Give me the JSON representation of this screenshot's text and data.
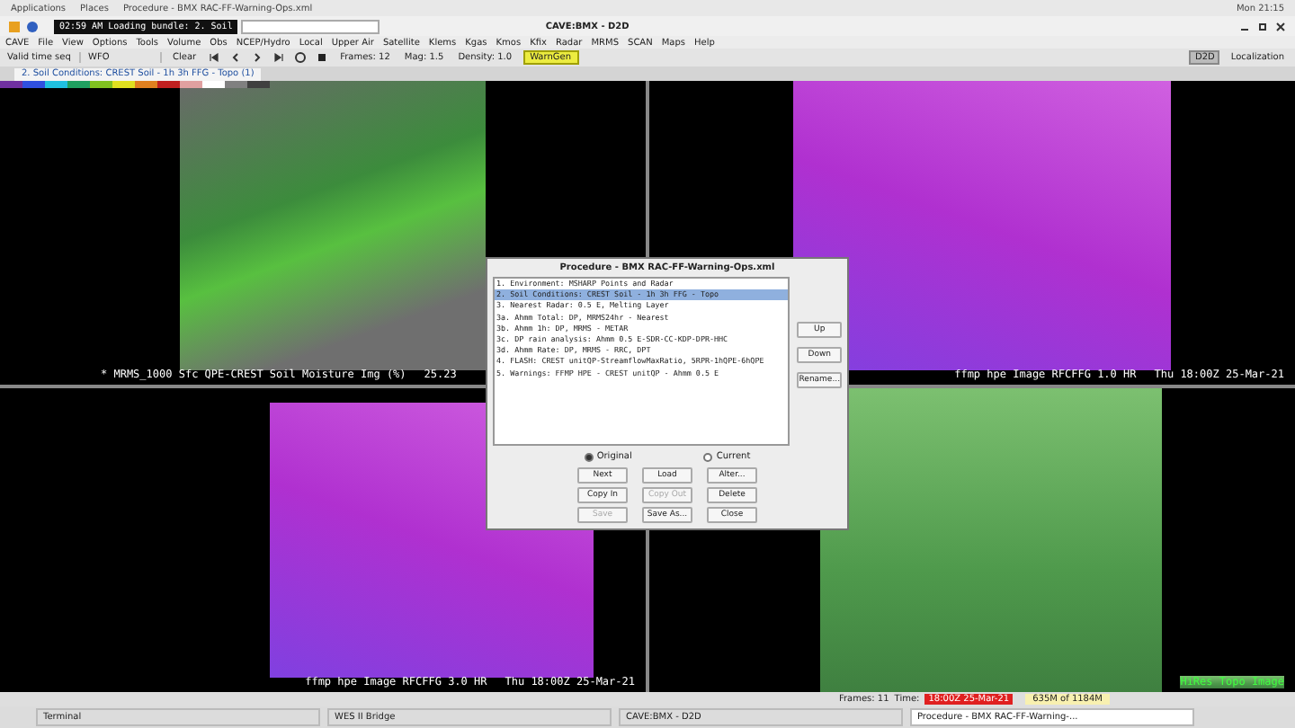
{
  "top_bar": {
    "menus": [
      "Applications",
      "Places"
    ],
    "window_title": "Procedure - BMX RAC-FF-Warning-Ops.xml",
    "clock": "Mon 21:15"
  },
  "window": {
    "title": "CAVE:BMX - D2D",
    "loading_text": "02:59 AM Loading bundle: 2. Soil"
  },
  "menu_bar": [
    "CAVE",
    "File",
    "View",
    "Options",
    "Tools",
    "Volume",
    "Obs",
    "NCEP/Hydro",
    "Local",
    "Upper Air",
    "Satellite",
    "Klems",
    "Kgas",
    "Kmos",
    "Kfix",
    "Radar",
    "MRMS",
    "SCAN",
    "Maps",
    "Help"
  ],
  "toolbar": {
    "time_seq": "Valid time seq",
    "scale": "WFO",
    "clear": "Clear",
    "frames": "Frames: 12",
    "mag": "Mag: 1.5",
    "density": "Density: 1.0",
    "warngen": "WarnGen",
    "perspectives": [
      {
        "label": "D2D",
        "selected": true
      },
      {
        "label": "Localization",
        "selected": false
      }
    ]
  },
  "tab": {
    "label": "2. Soil Conditions: CREST Soil - 1h 3h FFG - Topo (1)"
  },
  "panels": [
    {
      "kind": "soil",
      "caption": "* MRMS_1000 Sfc QPE-CREST Soil Moisture Img (%)",
      "reading": "25.23"
    },
    {
      "kind": "ffg",
      "caption": "ffmp hpe Image RFCFFG 1.0 HR",
      "reading": "Thu 18:00Z 25-Mar-21"
    },
    {
      "kind": "ffg",
      "caption": "ffmp hpe Image RFCFFG 3.0 HR",
      "reading": "Thu 18:00Z 25-Mar-21"
    },
    {
      "kind": "topo",
      "caption": "HiRes Topo Image"
    }
  ],
  "dialog": {
    "title": "Procedure - BMX RAC-FF-Warning-Ops.xml",
    "items": [
      {
        "label": "1. Environment: MSHARP Points and Radar",
        "selected": false
      },
      {
        "label": "2. Soil Conditions: CREST Soil - 1h 3h FFG - Topo",
        "selected": true
      },
      {
        "label": "3. Nearest Radar: 0.5 E, Melting Layer",
        "selected": false
      },
      {
        "label": "3a. Ahmm Total: DP, MRMS24hr - Nearest",
        "selected": false
      },
      {
        "label": "3b. Ahmm 1h: DP, MRMS - METAR",
        "selected": false
      },
      {
        "label": "3c. DP rain analysis: Ahmm 0.5 E-SDR-CC-KDP-DPR-HHC",
        "selected": false
      },
      {
        "label": "3d. Ahmm Rate: DP, MRMS - RRC, DPT",
        "selected": false
      },
      {
        "label": "4. FLASH: CREST unitQP-StreamflowMaxRatio, 5RPR-1hQPE-6hQPE",
        "selected": false
      },
      {
        "label": "5. Warnings: FFMP HPE - CREST unitQP - Ahmm 0.5 E",
        "selected": false
      }
    ],
    "side_buttons": [
      "Up",
      "Down",
      "Rename..."
    ],
    "modes": [
      {
        "label": "Original",
        "selected": true
      },
      {
        "label": "Current",
        "selected": false
      }
    ],
    "buttons": [
      {
        "label": "Next",
        "disabled": false
      },
      {
        "label": "Load",
        "disabled": false
      },
      {
        "label": "Alter...",
        "disabled": false
      },
      {
        "label": "Copy In",
        "disabled": false
      },
      {
        "label": "Copy Out",
        "disabled": true
      },
      {
        "label": "Delete",
        "disabled": false
      },
      {
        "label": "Save",
        "disabled": true
      },
      {
        "label": "Save As...",
        "disabled": false
      },
      {
        "label": "Close",
        "disabled": false
      }
    ]
  },
  "status_bar": {
    "frames": "Frames: 11",
    "time_label": "Time:",
    "time": "18:00Z 25-Mar-21",
    "memory": "635M of 1184M"
  },
  "taskbar": [
    {
      "label": "Terminal",
      "selected": false
    },
    {
      "label": "WES II Bridge",
      "selected": false
    },
    {
      "label": "CAVE:BMX - D2D",
      "selected": false
    },
    {
      "label": "Procedure - BMX RAC-FF-Warning-...",
      "selected": true
    }
  ]
}
